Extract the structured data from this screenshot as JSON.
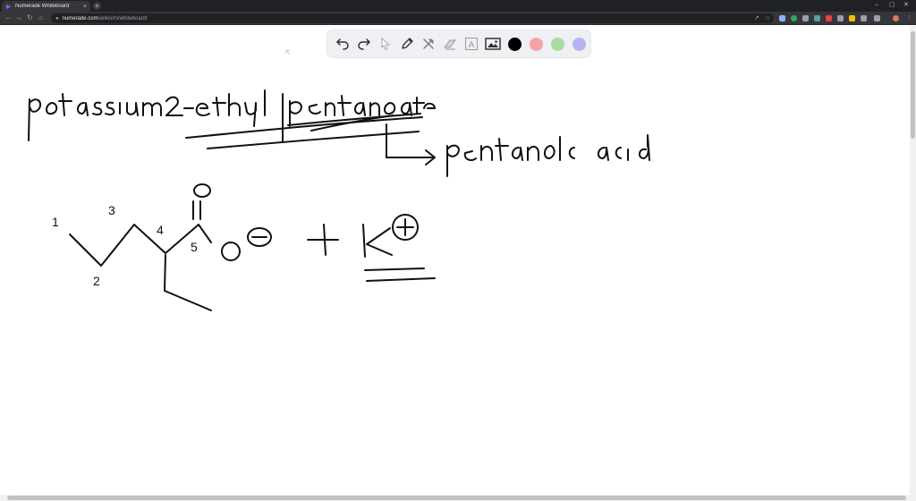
{
  "browser": {
    "tab_title": "Numerade Whiteboard",
    "tab_close": "×",
    "new_tab": "+",
    "url_host": "numerade.com",
    "url_path": "/ankis/m/whiteboard/",
    "window_controls": [
      "–",
      "▢",
      "✕"
    ]
  },
  "whiteboard": {
    "tools": [
      "undo-icon",
      "redo-icon",
      "select-icon",
      "pen-icon",
      "tools-icon",
      "eraser-icon",
      "text-icon",
      "image-icon"
    ],
    "text_tool_label": "A",
    "colors": [
      "#000000",
      "#f4a3a8",
      "#a8dca0",
      "#b7b3ee"
    ]
  },
  "handwriting": {
    "line1": "potassium 2-ethylpentanoate",
    "branch": "pentanoic acid",
    "carbon_numbers": [
      "1",
      "2",
      "3",
      "4",
      "5"
    ],
    "charge": "+ K"
  }
}
